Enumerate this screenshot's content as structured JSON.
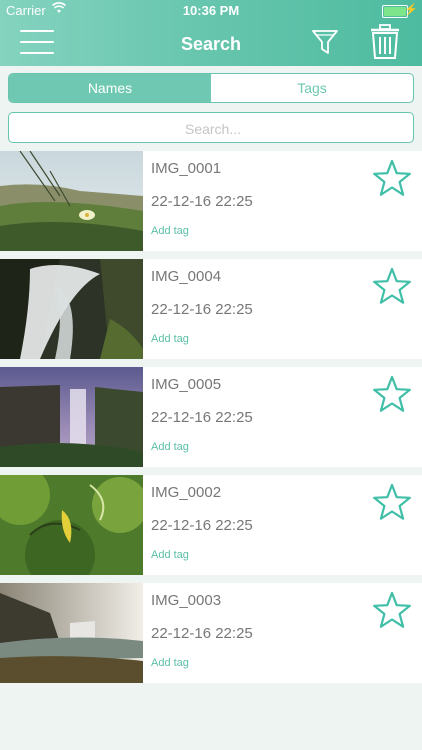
{
  "status_bar": {
    "carrier": "Carrier",
    "time": "10:36 PM",
    "wifi_icon": "wifi-icon",
    "battery_icon": "battery-icon",
    "battery_level": 1.0
  },
  "nav": {
    "title": "Search",
    "menu_icon": "hamburger-menu-icon",
    "filter_icon": "filter-icon",
    "trash_icon": "trash-icon"
  },
  "segments": {
    "names_label": "Names",
    "tags_label": "Tags",
    "selected": "Names"
  },
  "search": {
    "placeholder": "Search...",
    "value": ""
  },
  "colors": {
    "accent": "#66c5ad",
    "header_start": "#84d3bf",
    "header_end": "#4dbb9f",
    "background": "#eef4f2",
    "text_gray": "#777777"
  },
  "items": [
    {
      "name": "IMG_0001",
      "date": "22-12-16 22:25",
      "add_tag": "Add tag",
      "favorite": false
    },
    {
      "name": "IMG_0004",
      "date": "22-12-16 22:25",
      "add_tag": "Add tag",
      "favorite": false
    },
    {
      "name": "IMG_0005",
      "date": "22-12-16 22:25",
      "add_tag": "Add tag",
      "favorite": false
    },
    {
      "name": "IMG_0002",
      "date": "22-12-16 22:25",
      "add_tag": "Add tag",
      "favorite": false
    },
    {
      "name": "IMG_0003",
      "date": "22-12-16 22:25",
      "add_tag": "Add tag",
      "favorite": false
    }
  ]
}
